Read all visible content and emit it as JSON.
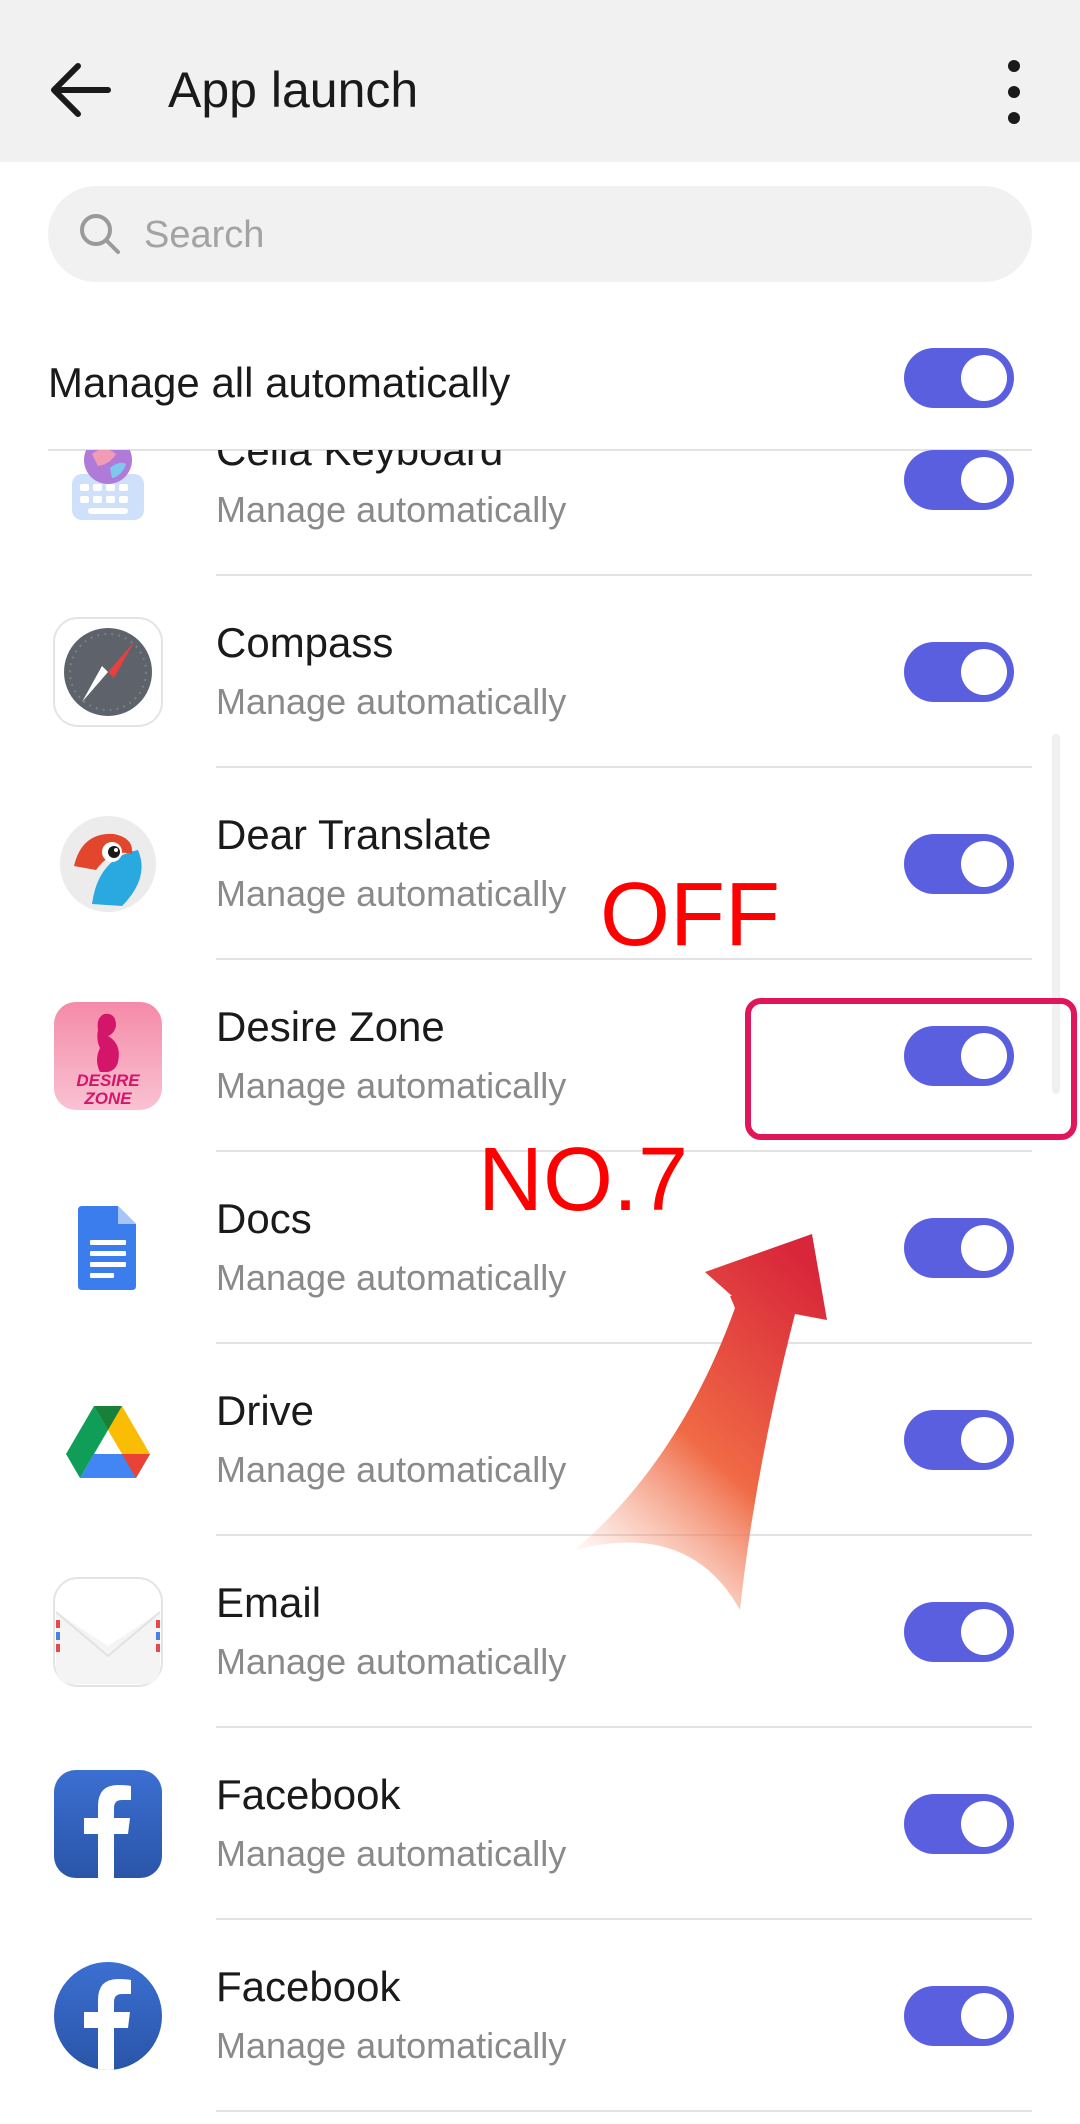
{
  "header": {
    "title": "App launch"
  },
  "search": {
    "placeholder": "Search"
  },
  "manage_all": {
    "label": "Manage all automatically",
    "enabled": true
  },
  "apps": [
    {
      "name": "Celia Keyboard",
      "status": "Manage automatically",
      "enabled": true,
      "icon": "celia-keyboard-icon"
    },
    {
      "name": "Compass",
      "status": "Manage automatically",
      "enabled": true,
      "icon": "compass-icon"
    },
    {
      "name": "Dear Translate",
      "status": "Manage automatically",
      "enabled": true,
      "icon": "dear-translate-icon"
    },
    {
      "name": "Desire Zone",
      "status": "Manage automatically",
      "enabled": true,
      "icon": "desire-zone-icon",
      "icon_text": "DESIRE ZONE"
    },
    {
      "name": "Docs",
      "status": "Manage automatically",
      "enabled": true,
      "icon": "docs-icon"
    },
    {
      "name": "Drive",
      "status": "Manage automatically",
      "enabled": true,
      "icon": "drive-icon"
    },
    {
      "name": "Email",
      "status": "Manage automatically",
      "enabled": true,
      "icon": "email-icon"
    },
    {
      "name": "Facebook",
      "status": "Manage automatically",
      "enabled": true,
      "icon": "facebook-square-icon"
    },
    {
      "name": "Facebook",
      "status": "Manage automatically",
      "enabled": true,
      "icon": "facebook-round-icon"
    }
  ],
  "annotations": {
    "off_label": "OFF",
    "step_label": "NO.7"
  },
  "colors": {
    "toggle_on": "#5a5fe0",
    "annotation_red": "#ff0000",
    "highlight_box": "#e0155a"
  }
}
